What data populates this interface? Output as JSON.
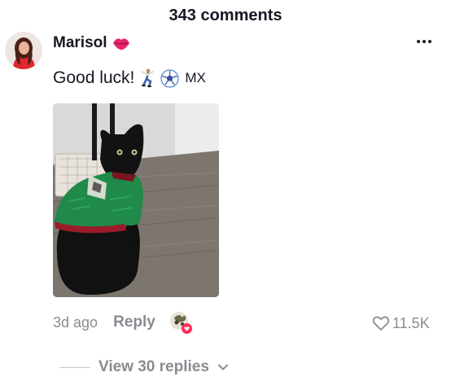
{
  "header": {
    "comment_count": "343 comments"
  },
  "comment": {
    "username": "Marisol",
    "username_badge_icon": "kiss-lips-icon",
    "text": "Good luck!",
    "emojis": [
      "dancing-man-icon",
      "soccer-ball-icon"
    ],
    "suffix": "MX",
    "photo_icon": "black-cat-in-mexico-jersey-photo",
    "time_ago": "3d ago",
    "reply_label": "Reply",
    "like_count": "11.5K",
    "view_replies_label": "View 30 replies"
  },
  "colors": {
    "muted": "#8a8b91",
    "text": "#161823",
    "accent_red": "#fe2c55"
  }
}
